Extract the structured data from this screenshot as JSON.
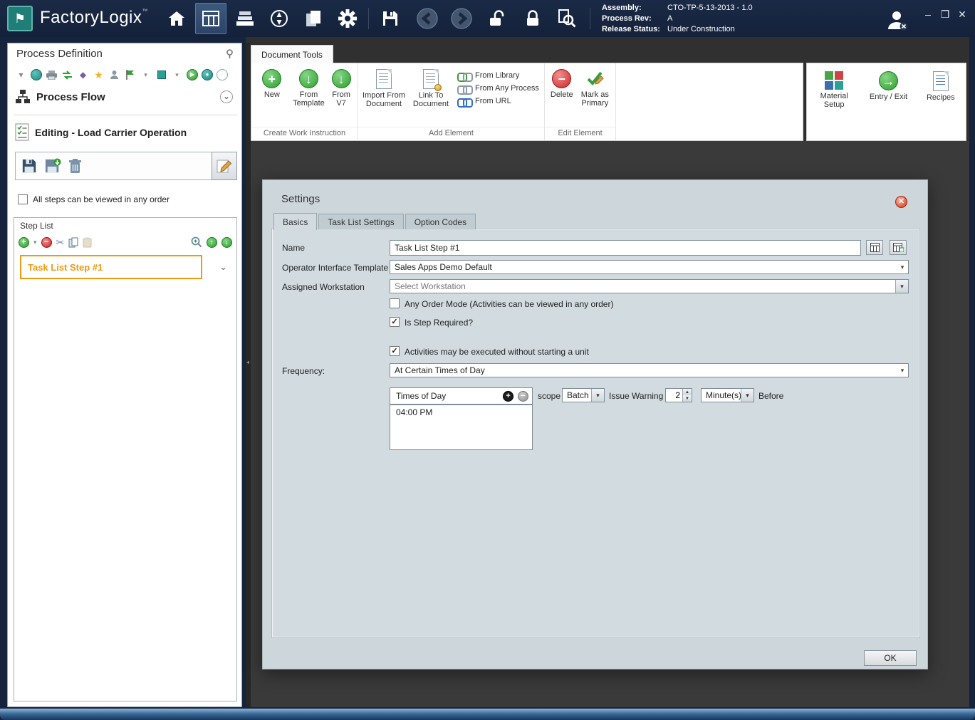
{
  "titlebar": {
    "app_name": "FactoryLogix",
    "trademark": "™",
    "info": {
      "assembly_label": "Assembly:",
      "assembly_value": "CTO-TP-5-13-2013 - 1.0",
      "process_rev_label": "Process Rev:",
      "process_rev_value": "A",
      "release_status_label": "Release Status:",
      "release_status_value": "Under Construction"
    },
    "window_controls": {
      "minimize": "–",
      "maximize": "❒",
      "close": "✕"
    }
  },
  "left_panel": {
    "title": "Process Definition",
    "process_flow_label": "Process Flow",
    "editing_label": "Editing - Load Carrier Operation",
    "any_order_checkbox_label": "All steps can be viewed in any order",
    "step_list": {
      "title": "Step List",
      "steps": [
        {
          "label": "Task List Step #1"
        }
      ]
    }
  },
  "ribbon": {
    "tab_label": "Document Tools",
    "groups": [
      {
        "label": "Create Work Instruction",
        "items": [
          {
            "label": "New"
          },
          {
            "label": "From Template"
          },
          {
            "label": "From V7"
          }
        ]
      },
      {
        "label": "Add Element",
        "items": [
          {
            "label": "Import From Document"
          },
          {
            "label": "Link To Document"
          },
          {
            "label": "From Library"
          },
          {
            "label": "From Any Process"
          },
          {
            "label": "From URL"
          }
        ]
      },
      {
        "label": "Edit Element",
        "items": [
          {
            "label": "Delete"
          },
          {
            "label": "Mark as Primary"
          }
        ]
      }
    ],
    "right_items": [
      {
        "label": "Material Setup"
      },
      {
        "label": "Entry / Exit"
      },
      {
        "label": "Recipes"
      }
    ]
  },
  "settings_dialog": {
    "title": "Settings",
    "tabs": [
      {
        "label": "Basics"
      },
      {
        "label": "Task List Settings"
      },
      {
        "label": "Option Codes"
      }
    ],
    "name_label": "Name",
    "name_value": "Task List Step #1",
    "operator_template_label": "Operator Interface Template",
    "operator_template_value": "Sales Apps Demo Default",
    "workstation_label": "Assigned Workstation",
    "workstation_placeholder": "Select Workstation",
    "any_order_label": "Any Order Mode (Activities can be viewed in any order)",
    "step_required_label": "Is Step Required?",
    "no_unit_label": "Activities may be executed without starting a unit",
    "frequency_label": "Frequency:",
    "frequency_value": "At Certain Times of Day",
    "times_panel": {
      "header": "Times of Day",
      "times": [
        "04:00 PM"
      ]
    },
    "scope_label": "scope",
    "scope_value": "Batch",
    "issue_warning_label": "Issue Warning",
    "issue_warning_value": "2",
    "warning_unit_value": "Minute(s)",
    "before_label": "Before",
    "ok_label": "OK"
  },
  "glyphs": {
    "plus": "+",
    "minus": "−",
    "check": "✓",
    "chevron_down": "▾",
    "chevron_small": "⌄",
    "arrow_down": "↓",
    "arrow_up": "↑",
    "arrow_right": "→",
    "scissors": "✂",
    "star": "★",
    "diamond": "◆",
    "play": "▶",
    "dot": "●"
  }
}
